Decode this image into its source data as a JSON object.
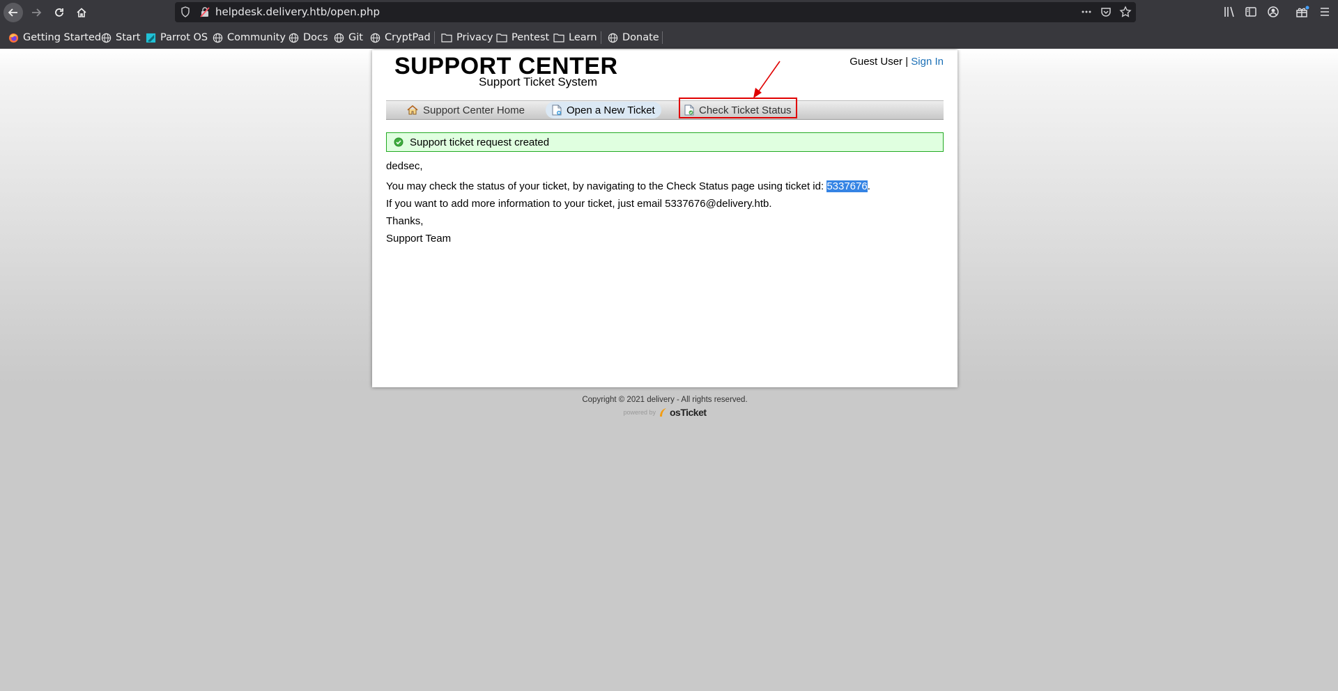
{
  "browser": {
    "url": "helpdesk.delivery.htb/open.php",
    "bookmarks": [
      {
        "label": "Getting Started",
        "icon": "firefox-icon"
      },
      {
        "label": "Start",
        "icon": "globe-icon"
      },
      {
        "label": "Parrot OS",
        "icon": "parrot-icon"
      },
      {
        "label": "Community",
        "icon": "globe-icon"
      },
      {
        "label": "Docs",
        "icon": "globe-icon"
      },
      {
        "label": "Git",
        "icon": "globe-icon"
      },
      {
        "label": "CryptPad",
        "icon": "globe-icon"
      },
      {
        "label": "Privacy",
        "icon": "folder-icon"
      },
      {
        "label": "Pentest",
        "icon": "folder-icon"
      },
      {
        "label": "Learn",
        "icon": "folder-icon"
      },
      {
        "label": "Donate",
        "icon": "globe-icon"
      }
    ]
  },
  "header": {
    "title": "SUPPORT CENTER",
    "subtitle": "Support Ticket System",
    "user_label": "Guest User",
    "separator": "|",
    "signin_label": "Sign In"
  },
  "nav": {
    "items": [
      {
        "label": "Support Center Home",
        "icon": "home-icon"
      },
      {
        "label": "Open a New Ticket",
        "icon": "new-ticket-icon"
      },
      {
        "label": "Check Ticket Status",
        "icon": "ticket-status-icon"
      }
    ]
  },
  "notice": {
    "text": "Support ticket request created"
  },
  "message": {
    "greeting": "dedsec,",
    "status_prefix": "You may check the status of your ticket, by navigating to the Check Status page using ticket id: ",
    "ticket_id": "5337676",
    "status_suffix": ".",
    "email_line": "If you want to add more information to your ticket, just email 5337676@delivery.htb.",
    "thanks": "Thanks,",
    "signature": "Support Team"
  },
  "footer": {
    "copyright": "Copyright © 2021 delivery - All rights reserved.",
    "powered_by": "powered by",
    "brand": "osTicket"
  },
  "colors": {
    "accent_link": "#1b6fb6",
    "notice_bg": "#e0ffe0",
    "notice_border": "#22aa22",
    "annotation_red": "#e00000",
    "selection": "#3584e4"
  }
}
